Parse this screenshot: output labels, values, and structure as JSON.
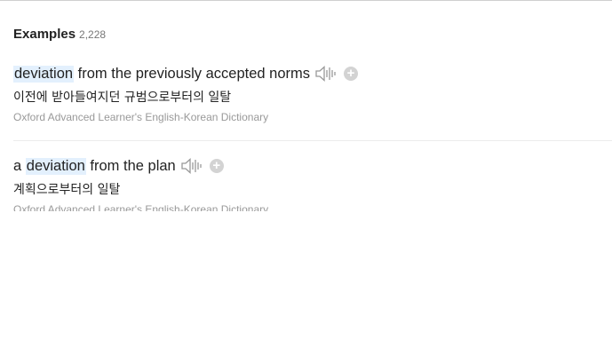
{
  "examples": {
    "title": "Examples",
    "count": "2,228"
  },
  "entries": [
    {
      "pre": "",
      "highlight": "deviation",
      "post": " from the previously accepted norms",
      "translation": "이전에 받아들여지던 규범으로부터의 일탈",
      "source": "Oxford Advanced Learner's English-Korean Dictionary"
    },
    {
      "pre": "a ",
      "highlight": "deviation",
      "post": " from the plan",
      "translation": "계획으로부터의 일탈",
      "source": "Oxford Advanced Learner's English-Korean Dictionary"
    }
  ],
  "icons": {
    "speaker": "speaker-icon",
    "add": "plus-icon"
  },
  "colors": {
    "highlight": "#e3f0fd",
    "source_text": "#999999",
    "add_button": "#d3d3d3"
  }
}
